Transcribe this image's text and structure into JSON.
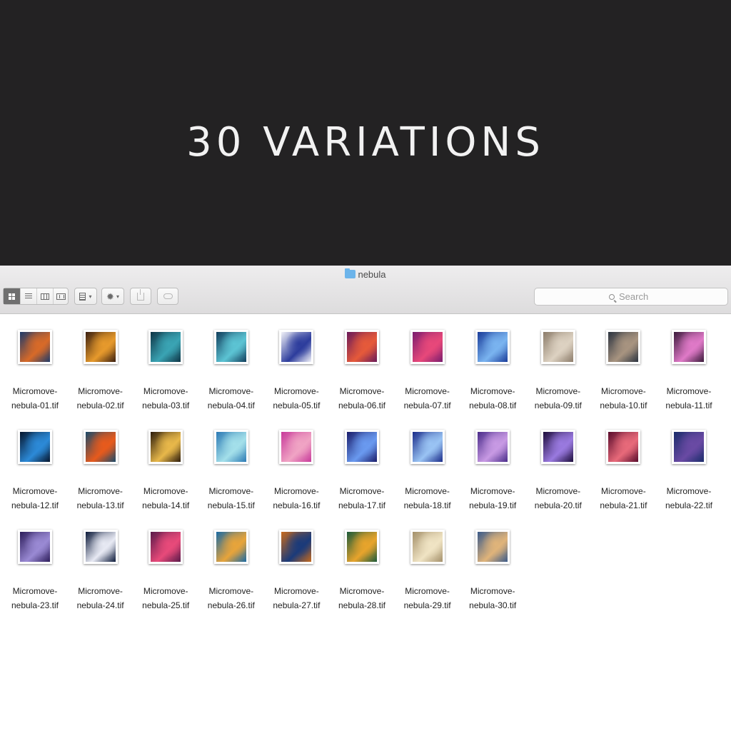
{
  "hero": {
    "title": "30 VARIATIONS"
  },
  "window": {
    "title": "nebula",
    "folder_icon": "folder-icon",
    "search_placeholder": "Search"
  },
  "toolbar": {
    "view_buttons": [
      "icon-view-icon",
      "list-view-icon",
      "column-view-icon",
      "cover-flow-view-icon"
    ],
    "active_view": "icon-view-icon",
    "arrange_icon": "arrange-icon",
    "action_icon": "gear-icon",
    "share_icon": "share-icon",
    "tags_icon": "tag-icon"
  },
  "files": [
    {
      "name": "Micromove-\nnebula-01.tif",
      "colors": [
        "#1e3a6a",
        "#d86a28"
      ]
    },
    {
      "name": "Micromove-\nnebula-02.tif",
      "colors": [
        "#3a1f10",
        "#e79a2c"
      ]
    },
    {
      "name": "Micromove-\nnebula-03.tif",
      "colors": [
        "#0e3445",
        "#3aa4b4"
      ]
    },
    {
      "name": "Micromove-\nnebula-04.tif",
      "colors": [
        "#123e5c",
        "#5cc4d4"
      ]
    },
    {
      "name": "Micromove-\nnebula-05.tif",
      "colors": [
        "#f2f2f8",
        "#2c3c9c"
      ]
    },
    {
      "name": "Micromove-\nnebula-06.tif",
      "colors": [
        "#6a1a5a",
        "#e65a3a"
      ]
    },
    {
      "name": "Micromove-\nnebula-07.tif",
      "colors": [
        "#7a1c6e",
        "#e8487a"
      ]
    },
    {
      "name": "Micromove-\nnebula-08.tif",
      "colors": [
        "#1a3c9a",
        "#7ab4f0"
      ]
    },
    {
      "name": "Micromove-\nnebula-09.tif",
      "colors": [
        "#8c7c6a",
        "#ddd2c2"
      ]
    },
    {
      "name": "Micromove-\nnebula-10.tif",
      "colors": [
        "#2c3440",
        "#a89480"
      ]
    },
    {
      "name": "Micromove-\nnebula-11.tif",
      "colors": [
        "#3a1a3a",
        "#e07ac8"
      ]
    },
    {
      "name": "Micromove-\nnebula-12.tif",
      "colors": [
        "#06152c",
        "#2c8ad8"
      ]
    },
    {
      "name": "Micromove-\nnebula-13.tif",
      "colors": [
        "#1a4a6a",
        "#e85a1c"
      ]
    },
    {
      "name": "Micromove-\nnebula-14.tif",
      "colors": [
        "#2c1c0c",
        "#e8b84a"
      ]
    },
    {
      "name": "Micromove-\nnebula-15.tif",
      "colors": [
        "#2c7ab4",
        "#a4e0ea"
      ]
    },
    {
      "name": "Micromove-\nnebula-16.tif",
      "colors": [
        "#c83a9a",
        "#f0a4c4"
      ]
    },
    {
      "name": "Micromove-\nnebula-17.tif",
      "colors": [
        "#1a1c6a",
        "#6a9af0"
      ]
    },
    {
      "name": "Micromove-\nnebula-18.tif",
      "colors": [
        "#1a2c8a",
        "#9ac4f4"
      ]
    },
    {
      "name": "Micromove-\nnebula-19.tif",
      "colors": [
        "#4a2c8a",
        "#c89ae4"
      ]
    },
    {
      "name": "Micromove-\nnebula-20.tif",
      "colors": [
        "#1c0c3a",
        "#9a7ae0"
      ]
    },
    {
      "name": "Micromove-\nnebula-21.tif",
      "colors": [
        "#5a0c2c",
        "#e86a7a"
      ]
    },
    {
      "name": "Micromove-\nnebula-22.tif",
      "colors": [
        "#1a2c6a",
        "#6a4aa4"
      ]
    },
    {
      "name": "Micromove-\nnebula-23.tif",
      "colors": [
        "#2c1c5a",
        "#9a8ad4"
      ]
    },
    {
      "name": "Micromove-\nnebula-24.tif",
      "colors": [
        "#0c1a3a",
        "#e8eaf4"
      ]
    },
    {
      "name": "Micromove-\nnebula-25.tif",
      "colors": [
        "#5a1a4a",
        "#e84a7a"
      ]
    },
    {
      "name": "Micromove-\nnebula-26.tif",
      "colors": [
        "#1a6aa4",
        "#e8a43a"
      ]
    },
    {
      "name": "Micromove-\nnebula-27.tif",
      "colors": [
        "#c86a1c",
        "#1a3a7a"
      ]
    },
    {
      "name": "Micromove-\nnebula-28.tif",
      "colors": [
        "#1a5a3a",
        "#e8a42c"
      ]
    },
    {
      "name": "Micromove-\nnebula-29.tif",
      "colors": [
        "#a4906a",
        "#f0e4c4"
      ]
    },
    {
      "name": "Micromove-\nnebula-30.tif",
      "colors": [
        "#3a5a8a",
        "#e0b47a"
      ]
    }
  ]
}
